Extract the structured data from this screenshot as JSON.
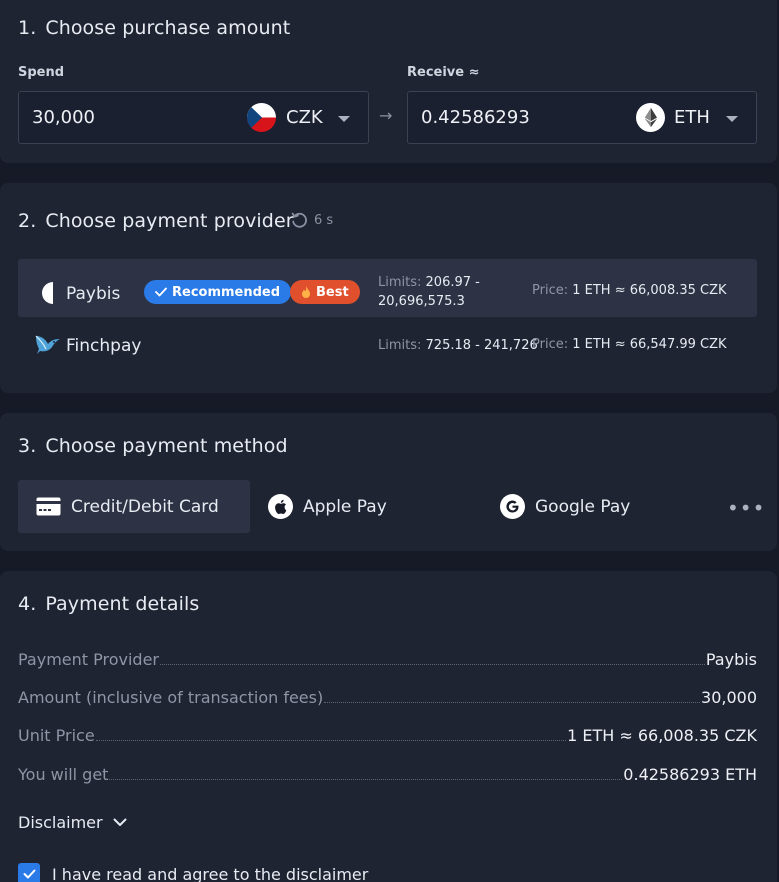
{
  "section1": {
    "number": "1.",
    "title": "Choose purchase amount",
    "spend": {
      "label": "Spend",
      "value": "30,000",
      "currency": "CZK",
      "icon": "czech-flag-icon"
    },
    "receive": {
      "label": "Receive ≈",
      "value": "0.42586293",
      "currency": "ETH",
      "icon": "ethereum-icon"
    }
  },
  "section2": {
    "number": "2.",
    "title": "Choose payment provider",
    "refresh_timer": "6 s",
    "providers": [
      {
        "name": "Paybis",
        "badge_recommended": "Recommended",
        "badge_best": "Best",
        "limits_label": "Limits:",
        "limits_line1": "206.97 -",
        "limits_line2": "20,696,575.3",
        "price_label": "Price:",
        "price": "1 ETH ≈ 66,008.35 CZK"
      },
      {
        "name": "Finchpay",
        "limits_label": "Limits:",
        "limits": "725.18 - 241,726",
        "price_label": "Price:",
        "price": "1 ETH ≈ 66,547.99 CZK"
      }
    ]
  },
  "section3": {
    "number": "3.",
    "title": "Choose payment method",
    "methods": [
      {
        "label": "Credit/Debit Card",
        "icon": "credit-card-icon",
        "selected": true
      },
      {
        "label": "Apple Pay",
        "icon": "apple-icon",
        "selected": false
      },
      {
        "label": "Google Pay",
        "icon": "google-icon",
        "selected": false
      }
    ],
    "more": "•••"
  },
  "section4": {
    "number": "4.",
    "title": "Payment details",
    "rows": [
      {
        "key": "Payment Provider",
        "value": "Paybis"
      },
      {
        "key": "Amount (inclusive of transaction fees)",
        "value": "30,000"
      },
      {
        "key": "Unit Price",
        "value": "1 ETH ≈ 66,008.35 CZK"
      },
      {
        "key": "You will get",
        "value": "0.42586293 ETH"
      }
    ],
    "disclaimer": "Disclaimer",
    "agree_text": "I have read and agree to the disclaimer",
    "agree_checked": true
  },
  "colors": {
    "background": "#151a26",
    "card": "#1f2433",
    "accent_blue": "#2a7ae8",
    "badge_orange": "#e0502d"
  }
}
